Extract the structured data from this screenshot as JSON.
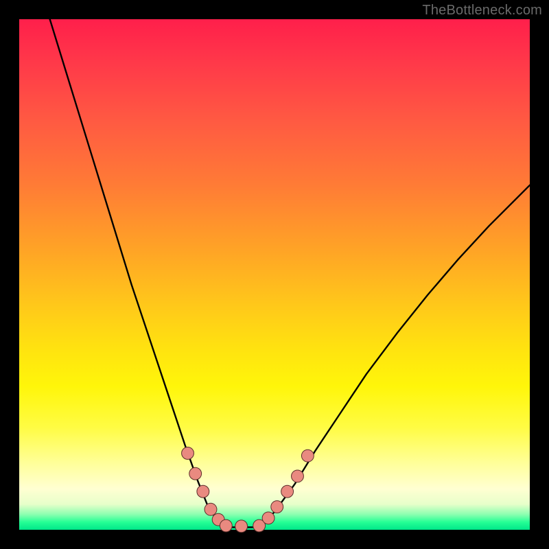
{
  "watermark": {
    "text": "TheBottleneck.com"
  },
  "colors": {
    "background": "#000000",
    "curve_stroke": "#000000",
    "marker_fill": "#e98a80",
    "marker_stroke": "#5b2e2a",
    "gradient_stops": [
      "#ff1f4b",
      "#ff3a49",
      "#ff5a42",
      "#ff7a36",
      "#ffa326",
      "#ffc81a",
      "#ffe40f",
      "#fff60a",
      "#fffc44",
      "#ffff9a",
      "#ffffd2",
      "#e7ffca",
      "#8bffb0",
      "#25ff95",
      "#00e68a"
    ]
  },
  "chart_data": {
    "type": "line",
    "title": "",
    "xlabel": "",
    "ylabel": "",
    "xlim": [
      0,
      100
    ],
    "ylim": [
      0,
      100
    ],
    "grid": false,
    "legend": false,
    "series": [
      {
        "name": "left-curve",
        "x": [
          6,
          10,
          14,
          18,
          22,
          26,
          30,
          32.5,
          35,
          37,
          39,
          40.5
        ],
        "y": [
          100,
          87,
          74,
          61,
          48,
          36,
          24,
          16.5,
          9.5,
          4.5,
          1.5,
          0.5
        ]
      },
      {
        "name": "floor-segment",
        "x": [
          40.5,
          47
        ],
        "y": [
          0.5,
          0.5
        ]
      },
      {
        "name": "right-curve",
        "x": [
          47,
          50,
          54,
          58,
          63,
          68,
          74,
          80,
          86,
          92,
          100
        ],
        "y": [
          0.5,
          3.5,
          9,
          15.5,
          23,
          30.5,
          38.5,
          46,
          53,
          59.5,
          67.5
        ]
      }
    ],
    "markers": {
      "name": "valley-markers",
      "points": [
        {
          "x": 33.0,
          "y": 15.0
        },
        {
          "x": 34.5,
          "y": 11.0
        },
        {
          "x": 36.0,
          "y": 7.5
        },
        {
          "x": 37.5,
          "y": 4.0
        },
        {
          "x": 39.0,
          "y": 2.0
        },
        {
          "x": 40.5,
          "y": 0.8
        },
        {
          "x": 43.5,
          "y": 0.7
        },
        {
          "x": 47.0,
          "y": 0.8
        },
        {
          "x": 48.8,
          "y": 2.3
        },
        {
          "x": 50.5,
          "y": 4.5
        },
        {
          "x": 52.5,
          "y": 7.5
        },
        {
          "x": 54.5,
          "y": 10.5
        },
        {
          "x": 56.5,
          "y": 14.5
        }
      ],
      "radius_data_units": 1.2
    }
  }
}
